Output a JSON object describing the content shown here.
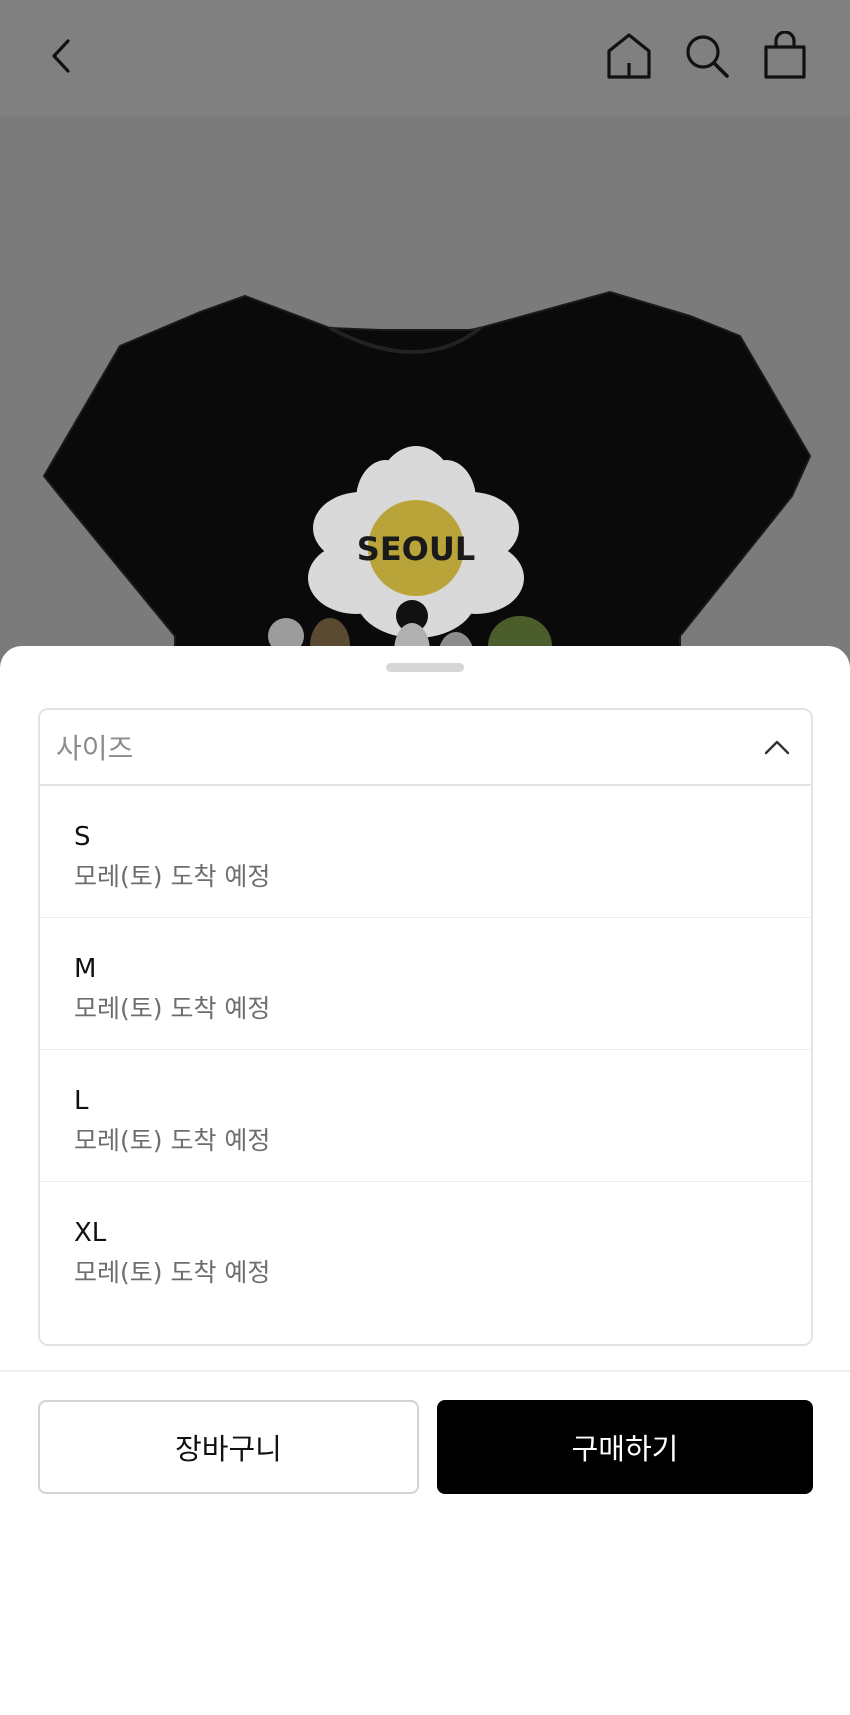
{
  "header": {
    "back_icon": "chevron-left-icon",
    "home_icon": "home-icon",
    "search_icon": "search-icon",
    "bag_icon": "shopping-bag-icon"
  },
  "product": {
    "print_text": "SEOUL"
  },
  "size_selector": {
    "placeholder": "사이즈",
    "expanded_icon": "chevron-up-icon",
    "options": [
      {
        "size": "S",
        "note": "모레(토) 도착 예정"
      },
      {
        "size": "M",
        "note": "모레(토) 도착 예정"
      },
      {
        "size": "L",
        "note": "모레(토) 도착 예정"
      },
      {
        "size": "XL",
        "note": "모레(토) 도착 예정"
      }
    ]
  },
  "actions": {
    "cart_label": "장바구니",
    "buy_label": "구매하기"
  }
}
